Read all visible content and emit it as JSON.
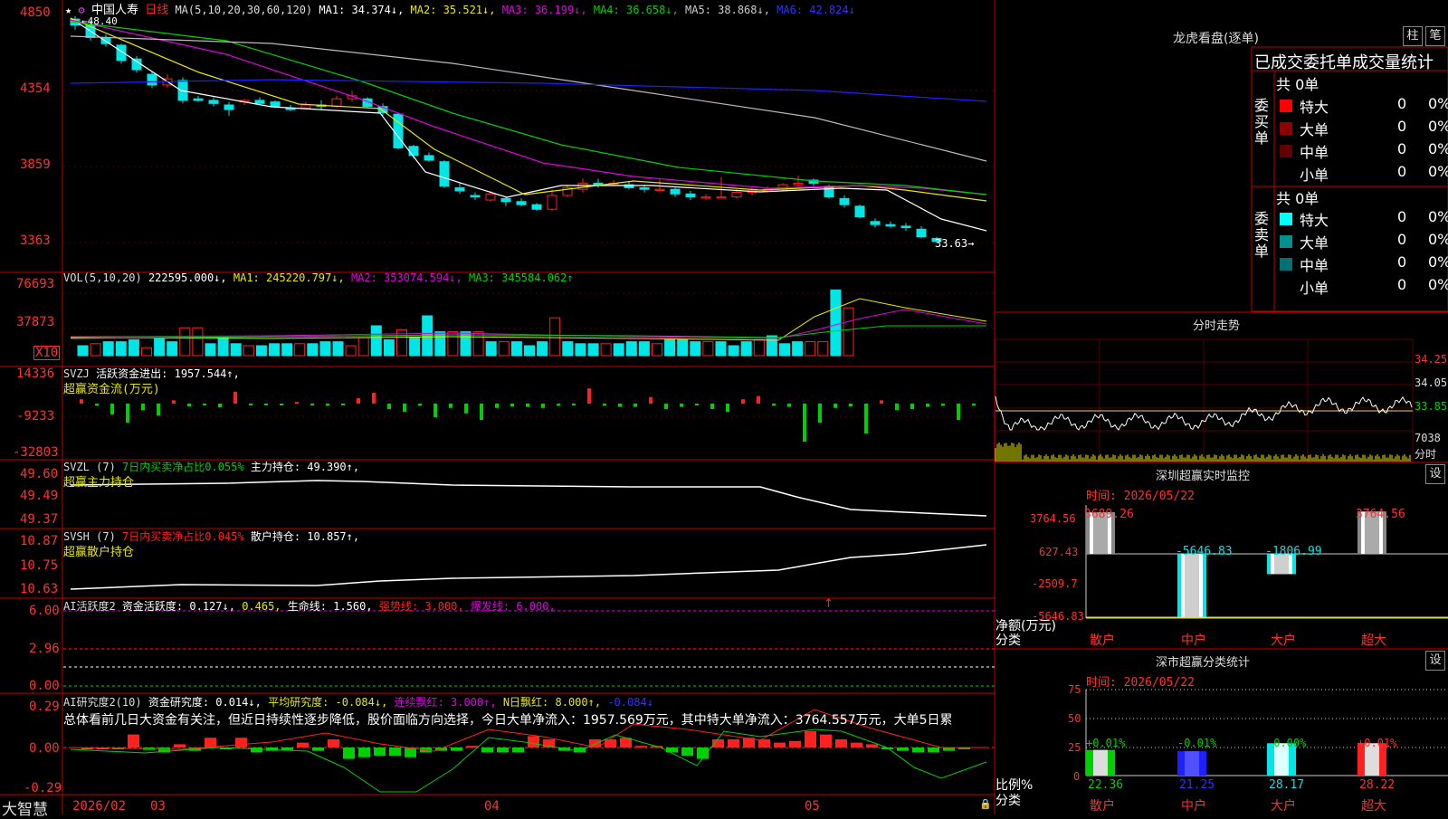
{
  "stock": {
    "star": "★",
    "name": "中国人寿",
    "period": "日线"
  },
  "colors": {
    "up": "#ff2020",
    "down": "#00e5e5",
    "frame": "#c00000",
    "green": "#00d000",
    "yellow": "#e8e800",
    "magenta": "#e000e0",
    "white": "#ffffff",
    "blue": "#2020ff"
  },
  "ma_line": {
    "label": "MA(5,10,20,30,60,120)",
    "items": [
      {
        "text": "MA1: 34.374↓,",
        "color": "#ffffff"
      },
      {
        "text": "MA2: 35.521↓,",
        "color": "#e8e800"
      },
      {
        "text": "MA3: 36.199↓,",
        "color": "#e000e0"
      },
      {
        "text": "MA4: 36.658↓,",
        "color": "#00d000"
      },
      {
        "text": "MA5: 38.868↓,",
        "color": "#cccccc"
      },
      {
        "text": "MA6: 42.824↓",
        "color": "#2020ff"
      }
    ]
  },
  "price_axis": [
    "4850",
    "4354",
    "3859",
    "3363"
  ],
  "price_marks": {
    "high": "48.40",
    "last": "33.63"
  },
  "vol": {
    "label": "VOL(5,10,20)",
    "value": "222595.000↓,",
    "ma": [
      {
        "text": "MA1: 245220.797↓,",
        "color": "#e8e800"
      },
      {
        "text": "MA2: 353074.594↓,",
        "color": "#e000e0"
      },
      {
        "text": "MA3: 345584.062↑",
        "color": "#00d000"
      }
    ],
    "axis": [
      "76693",
      "37873"
    ],
    "unit": "X10"
  },
  "svzj": {
    "label": "SVZJ",
    "field": "活跃资金进出: 1957.544↑,",
    "sub": "超赢资金流(万元)",
    "axis": [
      "14336",
      "-9233",
      "-32803"
    ]
  },
  "svzl": {
    "label": "SVZL (7)",
    "field1": "7日内买卖净占比0.055%",
    "field2": "主力持仓: 49.390↑,",
    "sub": "超赢主力持仓",
    "axis": [
      "49.60",
      "49.49",
      "49.37"
    ]
  },
  "svsh": {
    "label": "SVSH (7)",
    "field1": "7日内买卖净占比0.045%",
    "field2": "散户持仓: 10.857↑,",
    "sub": "超赢散户持仓",
    "axis": [
      "10.87",
      "10.75",
      "10.63"
    ]
  },
  "ai_act": {
    "label": "AI活跃度2",
    "field1": "资金活跃度: 0.127↓,",
    "field2": "0.465,",
    "field3": "生命线: 1.560,",
    "field4": "强势线: 3.000,",
    "field5": "爆发线: 6.000,",
    "axis": [
      "6.00",
      "2.96",
      "0.00"
    ]
  },
  "ai_res": {
    "label": "AI研究度2(10)",
    "field1": "资金研究度: 0.014↓,",
    "field2": "平均研究度: -0.084↓,",
    "field3": "连续飘红: 3.000↑,",
    "field4": "N日飘红: 8.000↑,",
    "field5": "-0.084↓",
    "comment": "总体看前几日大资金有关注，但近日持续性逐步降低，股价面临方向选择，今日大单净流入：1957.569万元，其中特大单净流入：3764.557万元，大单5日累",
    "axis": [
      "0.29",
      "0.00",
      "-0.29"
    ]
  },
  "bottom": {
    "brand": "大智慧",
    "dates": [
      "2026/02",
      "03",
      "04",
      "05"
    ]
  },
  "right": {
    "lhb_title": "龙虎看盘(逐单)",
    "tab_zhu": "柱",
    "tab_bi": "笔",
    "stats_title": "已成交委托单成交量统计",
    "buy_label": "委买单",
    "sell_label": "委卖单",
    "buy_total": "共 0单",
    "sell_total": "共 0单",
    "buy_rows": [
      {
        "name": "特大",
        "val": "0",
        "pct": "0%",
        "color": "#ff0000"
      },
      {
        "name": "大单",
        "val": "0",
        "pct": "0%",
        "color": "#900000"
      },
      {
        "name": "中单",
        "val": "0",
        "pct": "0%",
        "color": "#600000"
      },
      {
        "name": "小单",
        "val": "0",
        "pct": "0%",
        "color": ""
      }
    ],
    "sell_rows": [
      {
        "name": "特大",
        "val": "0",
        "pct": "0%",
        "color": "#00ffff"
      },
      {
        "name": "大单",
        "val": "0",
        "pct": "0%",
        "color": "#009090"
      },
      {
        "name": "中单",
        "val": "0",
        "pct": "0%",
        "color": "#007070"
      },
      {
        "name": "小单",
        "val": "0",
        "pct": "0%",
        "color": ""
      }
    ],
    "intraday_title": "分时走势",
    "intraday_axis": [
      "34.25",
      "34.05",
      "33.85"
    ],
    "intraday_vol": "7038",
    "intraday_unit": "分时",
    "monitor_title": "深圳超赢实时监控",
    "monitor_set": "设",
    "monitor_time": "时间: 2026/05/22",
    "monitor_axis": [
      "3764.56",
      "627.43",
      "-2509.7",
      "-5646.83"
    ],
    "monitor_ylabel": "净额(万元)",
    "monitor_xlabel": "分类",
    "monitor_bars": [
      {
        "cat": "散户",
        "label": "3689.26",
        "value": 3689.26
      },
      {
        "cat": "中户",
        "label": "-5646.83",
        "value": -5646.83
      },
      {
        "cat": "大户",
        "label": "-1806.99",
        "value": -1806.99
      },
      {
        "cat": "超大",
        "label": "3764.56",
        "value": 3764.56
      }
    ],
    "class_title": "深市超赢分类统计",
    "class_set": "设",
    "class_time": "时间: 2026/05/22",
    "class_axis": [
      "75",
      "50",
      "25",
      "0"
    ],
    "class_ylabel": "比例%",
    "class_xlabel": "分类",
    "class_bars": [
      {
        "cat": "散户",
        "top": "+0.01%",
        "val": "22.36",
        "value": 22.36,
        "color": "#00d000"
      },
      {
        "cat": "中户",
        "top": "-0.01%",
        "val": "21.25",
        "value": 21.25,
        "color": "#2020ff"
      },
      {
        "cat": "大户",
        "top": "-0.00%",
        "val": "28.17",
        "value": 28.17,
        "color": "#00e5e5"
      },
      {
        "cat": "超大",
        "top": "+0.01%",
        "val": "28.22",
        "value": 28.22,
        "color": "#ff2020"
      }
    ]
  }
}
